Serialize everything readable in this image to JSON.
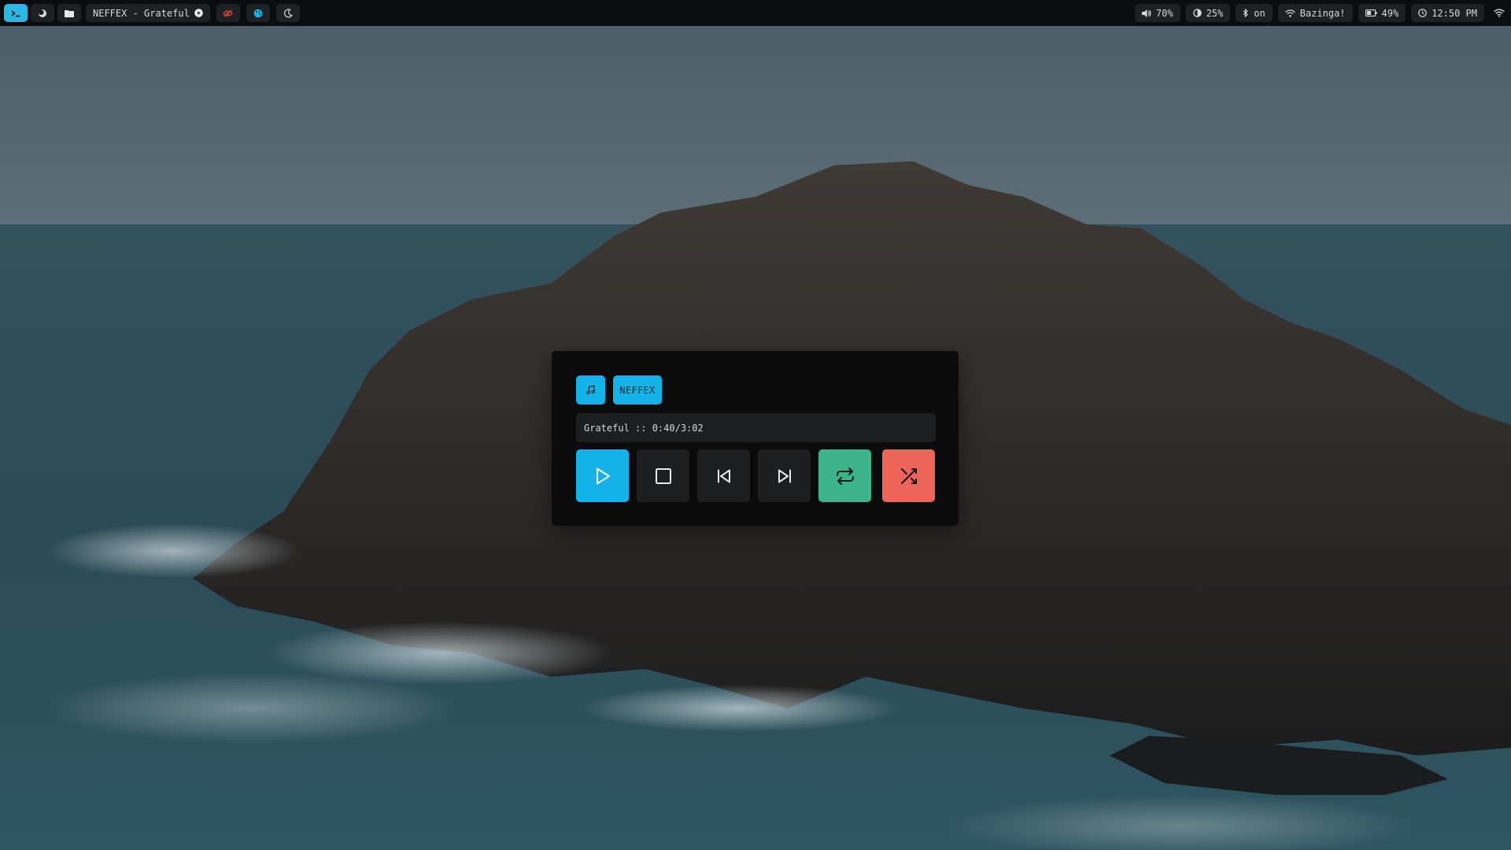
{
  "topbar": {
    "left": {
      "terminal_icon": "terminal-icon",
      "launcher_icon": "moon-swirl-icon",
      "files_icon": "folder-icon",
      "media_title": "NEFFEX - Grateful",
      "media_status_icon": "play-circle-icon",
      "eye_icon": "eye-off-icon",
      "palette_icon": "palette-icon",
      "night_icon": "moon-icon"
    },
    "right": {
      "volume": "70%",
      "brightness": "25%",
      "bluetooth": "on",
      "wifi": "Bazinga!",
      "battery": "49%",
      "clock": "12:50 PM"
    }
  },
  "player": {
    "artist": "NEFFEX",
    "track_line": "Grateful :: 0:40/3:02",
    "controls": [
      "play",
      "stop",
      "previous",
      "next",
      "repeat",
      "shuffle"
    ]
  },
  "colors": {
    "accent": "#11b3e8",
    "repeat": "#3cb38a",
    "shuffle": "#ef6459",
    "bar": "#0b0c0d",
    "surface": "#1c1e20"
  }
}
